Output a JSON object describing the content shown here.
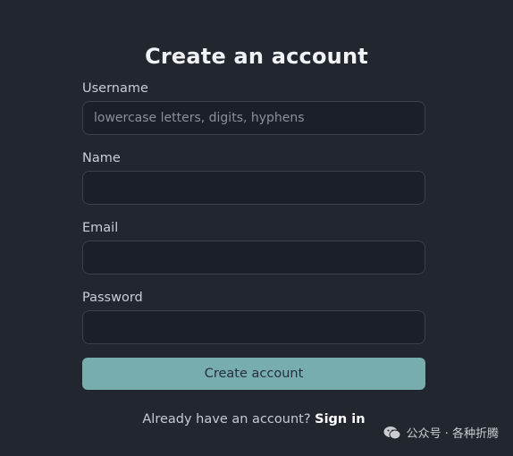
{
  "page": {
    "title": "Create an account"
  },
  "form": {
    "username": {
      "label": "Username",
      "value": "",
      "placeholder": "lowercase letters, digits, hyphens"
    },
    "name": {
      "label": "Name",
      "value": "",
      "placeholder": ""
    },
    "email": {
      "label": "Email",
      "value": "",
      "placeholder": ""
    },
    "password": {
      "label": "Password",
      "value": "",
      "placeholder": ""
    },
    "submit_label": "Create account"
  },
  "footer": {
    "prompt": "Already have an account?",
    "signin_label": "Sign in"
  },
  "watermark": {
    "text": "公众号 · 各种折腾",
    "icon": "wechat-icon"
  },
  "colors": {
    "background": "#21262f",
    "input_background": "#1b1f27",
    "input_border": "#3a414d",
    "button": "#78adad",
    "title": "#f1f3f6"
  }
}
